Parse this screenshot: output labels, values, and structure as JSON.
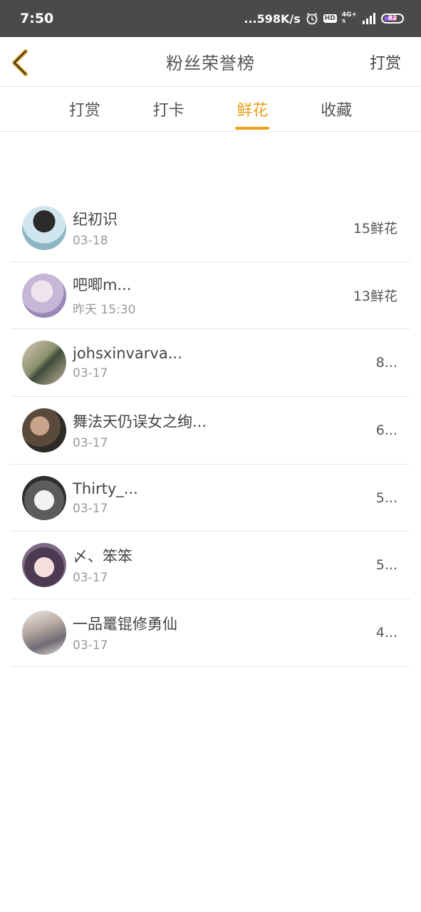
{
  "status_bar": {
    "time": "7:50",
    "net_speed": "...598K/s",
    "hd": "HD",
    "network": "4G+",
    "battery": "82"
  },
  "header": {
    "title": "粉丝荣誉榜",
    "right_action": "打赏"
  },
  "tabs": [
    {
      "label": "打赏",
      "active": false
    },
    {
      "label": "打卡",
      "active": false
    },
    {
      "label": "鲜花",
      "active": true
    },
    {
      "label": "收藏",
      "active": false
    }
  ],
  "accent_color": "#e8a21e",
  "rows": [
    {
      "name": "纪初识",
      "date": "03-18",
      "count": "15鲜花"
    },
    {
      "name": "吧唧m...",
      "date": "昨天 15:30",
      "count": "13鲜花"
    },
    {
      "name": "johsxinvarva...",
      "date": "03-17",
      "count": "8..."
    },
    {
      "name": "舞法天仍误女之绚...",
      "date": "03-17",
      "count": "6..."
    },
    {
      "name": "Thirty_...",
      "date": "03-17",
      "count": "5..."
    },
    {
      "name": "〆、笨笨",
      "date": "03-17",
      "count": "5..."
    },
    {
      "name": "一品鼍锟修勇仙",
      "date": "03-17",
      "count": "4..."
    }
  ]
}
